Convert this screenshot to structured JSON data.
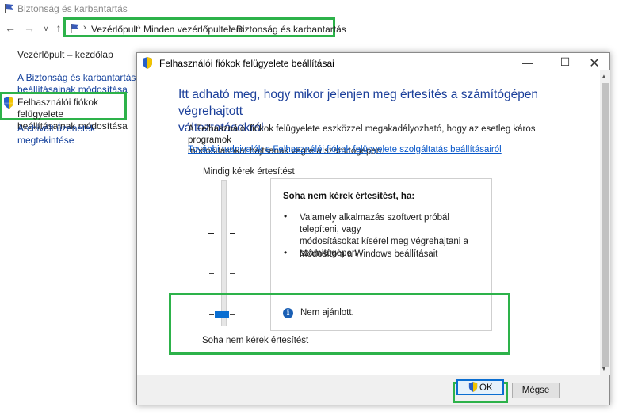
{
  "window": {
    "title": "Biztonság és karbantartás"
  },
  "breadcrumb": {
    "items": [
      "Vezérlőpult",
      "Minden vezérlőpultelem",
      "Biztonság és karbantartás"
    ]
  },
  "sidebar": {
    "home": "Vezérlőpult – kezdőlap",
    "items": [
      {
        "line1": "A Biztonság és karbantartás",
        "line2": "beállításainak módosítása"
      },
      {
        "line1": "Felhasználói fiókok felügyelete",
        "line2": "beállításainak módosítása"
      },
      {
        "line1": "Archivált üzenetek",
        "line2": "megtekintése"
      }
    ]
  },
  "dialog": {
    "title": "Felhasználói fiókok felügyelete beállításai",
    "heading_line1": "Itt adható meg, hogy mikor jelenjen meg értesítés a számítógépen végrehajtott",
    "heading_line2": "változtatásokról",
    "desc_line1": "A Felhasználói fiókok felügyelete eszközzel megakadályozható, hogy az esetleg káros programok",
    "desc_line2": "módosításokat hajtsanak végre a számítógépen.",
    "link": "További tudnivalók a Felhasználói fiókok felügyelete szolgáltatás beállításairól",
    "slider": {
      "top_label": "Mindig kérek értesítést",
      "bottom_label": "Soha nem kérek értesítést",
      "level_index": 3,
      "levels": 4
    },
    "info": {
      "heading": "Soha nem kérek értesítést, ha:",
      "bullets": [
        {
          "l1": "Valamely alkalmazás szoftvert próbál telepíteni, vagy",
          "l2": "módosításokat kísérel meg végrehajtani a",
          "l3": "számítógépen"
        },
        {
          "l1": "Módosítom a Windows beállításait"
        }
      ],
      "note": "Nem ajánlott."
    },
    "buttons": {
      "ok": "OK",
      "cancel": "Mégse"
    }
  },
  "colors": {
    "highlight": "#2db24a",
    "link": "#0a58c9",
    "heading": "#1b3f9a",
    "accent": "#0a6ed1"
  },
  "icons": [
    "flag-icon",
    "back-icon",
    "forward-icon",
    "dropdown-icon",
    "up-icon",
    "shield-icon",
    "info-icon",
    "minimize-icon",
    "maximize-icon",
    "close-icon"
  ]
}
